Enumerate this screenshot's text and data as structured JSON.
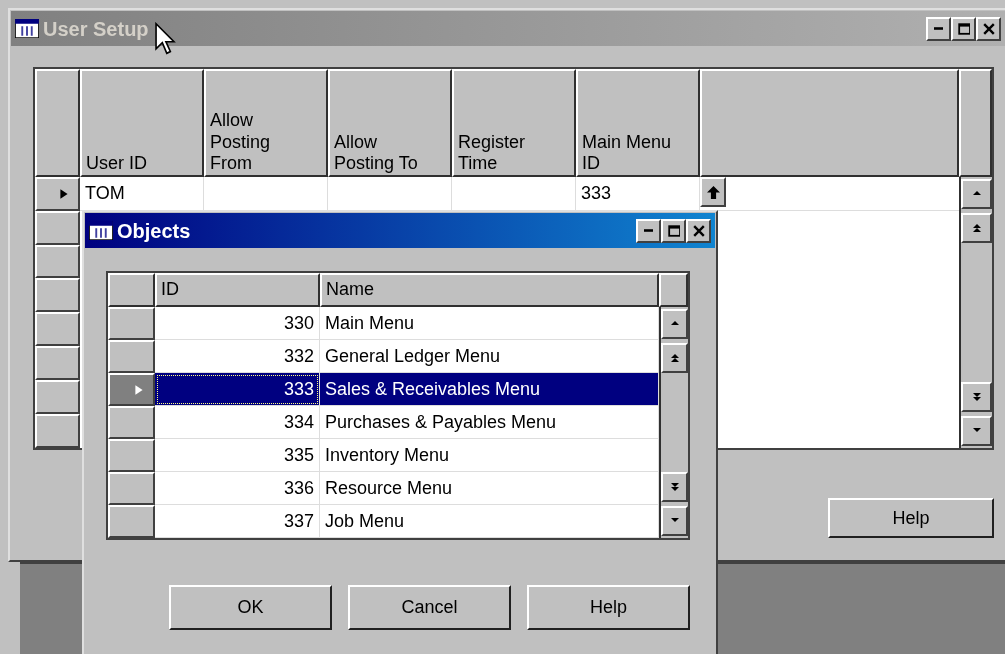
{
  "main_window": {
    "title": "User Setup",
    "active": false,
    "columns": [
      "User ID",
      "Allow Posting From",
      "Allow Posting To",
      "Register Time",
      "Main Menu ID"
    ],
    "rows": [
      {
        "user_id": "TOM",
        "main_menu_id": "333",
        "selected": true
      }
    ],
    "buttons": [
      "Help"
    ]
  },
  "dialog": {
    "title": "Objects",
    "active": true,
    "columns": [
      "ID",
      "Name"
    ],
    "rows": [
      {
        "id": "330",
        "name": "Main Menu",
        "selected": false
      },
      {
        "id": "332",
        "name": "General Ledger Menu",
        "selected": false
      },
      {
        "id": "333",
        "name": "Sales & Receivables Menu",
        "selected": true
      },
      {
        "id": "334",
        "name": "Purchases & Payables Menu",
        "selected": false
      },
      {
        "id": "335",
        "name": "Inventory Menu",
        "selected": false
      },
      {
        "id": "336",
        "name": "Resource Menu",
        "selected": false
      },
      {
        "id": "337",
        "name": "Job Menu",
        "selected": false
      }
    ],
    "buttons": [
      "OK",
      "Cancel",
      "Help"
    ]
  }
}
